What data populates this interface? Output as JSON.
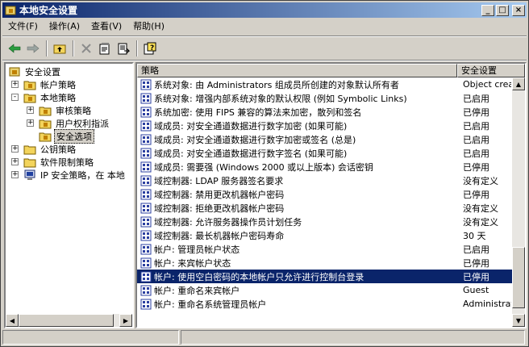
{
  "window": {
    "title": "本地安全设置",
    "buttons": {
      "minimize": "_",
      "maximize": "□",
      "close": "×"
    }
  },
  "menubar": {
    "items": [
      {
        "label": "文件(F)"
      },
      {
        "label": "操作(A)"
      },
      {
        "label": "查看(V)"
      },
      {
        "label": "帮助(H)"
      }
    ]
  },
  "toolbar": {
    "icons": [
      "back-arrow-icon",
      "forward-arrow-icon",
      "up-folder-icon",
      "delete-icon",
      "properties-icon",
      "export-list-icon",
      "help-icon"
    ]
  },
  "tree": {
    "items": [
      {
        "label": "安全设置",
        "level": 0,
        "expander": "none"
      },
      {
        "label": "帐户策略",
        "level": 1,
        "expander": "+"
      },
      {
        "label": "本地策略",
        "level": 1,
        "expander": "-"
      },
      {
        "label": "审核策略",
        "level": 2,
        "expander": "+"
      },
      {
        "label": "用户权利指派",
        "level": 2,
        "expander": "+"
      },
      {
        "label": "安全选项",
        "level": 2,
        "expander": "none",
        "selected": true
      },
      {
        "label": "公钥策略",
        "level": 1,
        "expander": "+"
      },
      {
        "label": "软件限制策略",
        "level": 1,
        "expander": "+"
      },
      {
        "label": "IP 安全策略，在 本地",
        "level": 1,
        "expander": "+"
      }
    ]
  },
  "list": {
    "columns": {
      "policy": "策略",
      "setting": "安全设置"
    },
    "rows": [
      {
        "policy": "系统对象: 由 Administrators 组成员所创建的对象默认所有者",
        "setting": "Object creator"
      },
      {
        "policy": "系统对象: 增强内部系统对象的默认权限 (例如 Symbolic Links)",
        "setting": "已启用"
      },
      {
        "policy": "系统加密: 使用 FIPS 兼容的算法来加密，散列和签名",
        "setting": "已停用"
      },
      {
        "policy": "域成员: 对安全通道数据进行数字加密 (如果可能)",
        "setting": "已启用"
      },
      {
        "policy": "域成员: 对安全通道数据进行数字加密或签名 (总是)",
        "setting": "已启用"
      },
      {
        "policy": "域成员: 对安全通道数据进行数字签名 (如果可能)",
        "setting": "已启用"
      },
      {
        "policy": "域成员: 需要强 (Windows 2000 或以上版本) 会话密钥",
        "setting": "已停用"
      },
      {
        "policy": "域控制器: LDAP 服务器签名要求",
        "setting": "没有定义"
      },
      {
        "policy": "域控制器: 禁用更改机器帐户密码",
        "setting": "已停用"
      },
      {
        "policy": "域控制器: 拒绝更改机器帐户密码",
        "setting": "没有定义"
      },
      {
        "policy": "域控制器: 允许服务器操作员计划任务",
        "setting": "没有定义"
      },
      {
        "policy": "域控制器: 最长机器帐户密码寿命",
        "setting": "30 天"
      },
      {
        "policy": "帐户: 管理员帐户状态",
        "setting": "已启用"
      },
      {
        "policy": "帐户: 来宾帐户状态",
        "setting": "已停用"
      },
      {
        "policy": "帐户: 使用空白密码的本地帐户只允许进行控制台登录",
        "setting": "已停用",
        "selected": true
      },
      {
        "policy": "帐户: 重命名来宾帐户",
        "setting": "Guest"
      },
      {
        "policy": "帐户: 重命名系统管理员帐户",
        "setting": "Administrator"
      }
    ]
  },
  "colors": {
    "titlebar_start": "#0a246a",
    "titlebar_end": "#a6caf0",
    "selection": "#0a246a",
    "face": "#d4d0c8",
    "policy_icon": "#2b3fa0"
  }
}
